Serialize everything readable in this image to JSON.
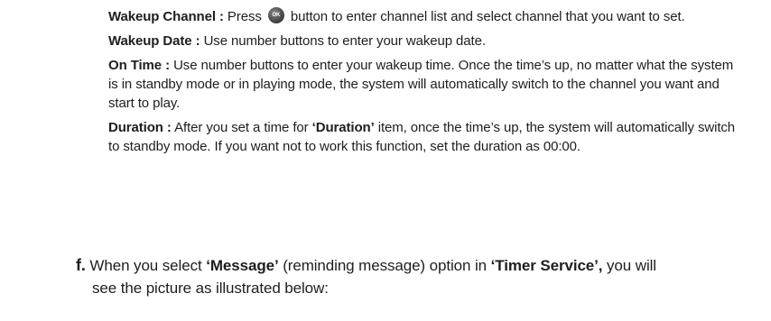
{
  "wakeup_channel": {
    "term": "Wakeup Channel :",
    "text_before_icon": " Press ",
    "icon_glyph": "OK",
    "icon_name": "ok-button-icon",
    "text_after_icon": " button to enter channel list and select channel that you want to set."
  },
  "wakeup_date": {
    "term": "Wakeup Date :",
    "text": " Use number buttons to enter your wakeup date."
  },
  "on_time": {
    "term": "On Time :",
    "text": " Use number buttons to enter your wakeup time. Once the time’s up, no matter what the system is in standby mode or in playing mode, the system will automatically switch to the channel you want and start to play."
  },
  "duration": {
    "term": "Duration :",
    "text_1": " After you set a time for ",
    "quoted": "‘Duration’",
    "text_2": " item, once the time’s up, the system will automatically switch to standby mode. If you want not to work this function, set the duration as 00:00."
  },
  "step_f": {
    "marker": "f.",
    "text_1": " When you select ",
    "quoted_1": "‘Message’",
    "text_2": " (reminding message) option in ",
    "quoted_2": "‘Timer Service’,",
    "text_3": " you will",
    "line_2": "see the picture as illustrated below:"
  }
}
